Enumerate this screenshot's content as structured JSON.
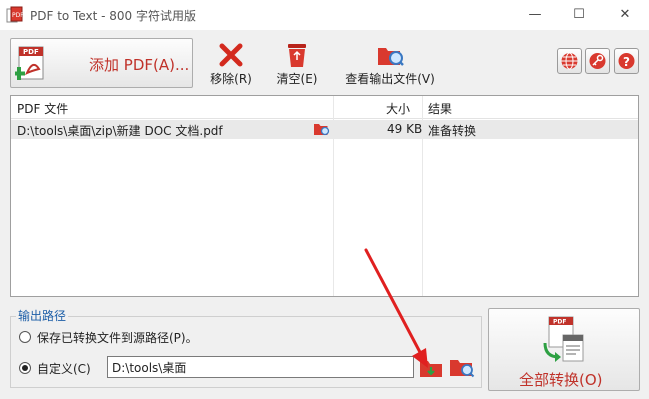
{
  "window": {
    "title": "PDF to Text - 800 字符试用版",
    "minimize_glyph": "—",
    "maximize_glyph": "☐",
    "close_glyph": "✕"
  },
  "toolbar": {
    "add_pdf_label": "添加 PDF(A)...",
    "remove_label": "移除(R)",
    "clear_label": "清空(E)",
    "view_output_label": "查看输出文件(V)"
  },
  "file_list": {
    "columns": [
      "PDF 文件",
      "大小",
      "结果"
    ],
    "rows": [
      {
        "file": "D:\\tools\\桌面\\zip\\新建 DOC 文档.pdf",
        "size": "49 KB",
        "result": "准备转换"
      }
    ]
  },
  "output_path": {
    "group_title": "输出路径",
    "option_source_label": "保存已转换文件到源路径(P)。",
    "option_custom_label": "自定义(C)",
    "custom_path_value": "D:\\tools\\桌面",
    "selected": "custom"
  },
  "convert_all_label": "全部转换(O)",
  "colors": {
    "accent_red": "#c0322a",
    "group_title_blue": "#1e5fa8",
    "arrow_red": "#e02020"
  }
}
